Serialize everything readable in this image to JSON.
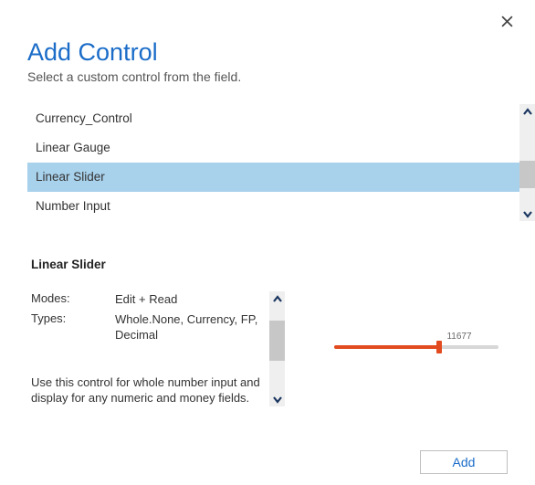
{
  "header": {
    "title": "Add Control",
    "subtitle": "Select a custom control from the field."
  },
  "controls": {
    "items": [
      {
        "label": "Currency_Control"
      },
      {
        "label": "Linear Gauge"
      },
      {
        "label": "Linear Slider"
      },
      {
        "label": "Number Input"
      }
    ]
  },
  "details": {
    "name": "Linear Slider",
    "modes_label": "Modes:",
    "modes_value": "Edit + Read",
    "types_label": "Types:",
    "types_value": "Whole.None, Currency, FP, Decimal",
    "description": "Use this control for whole number input and display for any numeric and money fields."
  },
  "preview": {
    "slider_value": "11677"
  },
  "footer": {
    "add_label": "Add"
  }
}
